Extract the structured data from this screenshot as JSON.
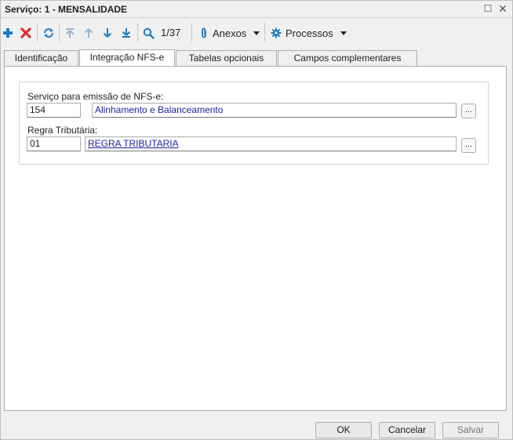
{
  "window": {
    "title": "Serviço: 1 - MENSALIDADE",
    "maximize_glyph": "☐",
    "close_glyph": "✕"
  },
  "toolbar": {
    "add_icon": "plus-icon",
    "delete_icon": "x-icon",
    "refresh_icon": "refresh-icon",
    "first_icon": "arrow-first-icon",
    "prev_icon": "arrow-up-icon",
    "next_icon": "arrow-down-icon",
    "last_icon": "arrow-last-icon",
    "search_icon": "search-icon",
    "record_position": "1/37",
    "attachments_label": "Anexos",
    "processes_label": "Processos",
    "accent_color": "#1e7bc4",
    "delete_color": "#d9312b"
  },
  "tabs": [
    {
      "label": "Identificação",
      "active": false
    },
    {
      "label": "Integração NFS-e",
      "active": true
    },
    {
      "label": "Tabelas opcionais",
      "active": false
    },
    {
      "label": "Campos complementares",
      "active": false
    }
  ],
  "form": {
    "service_label": "Serviço para emissão de NFS-e:",
    "service_code": "154",
    "service_description": "Alinhamento e Balanceamento",
    "tax_rule_label": "Regra Tributária:",
    "tax_rule_code": "01",
    "tax_rule_description": "REGRA TRIBUTARIA",
    "lookup_button": "...",
    "link_color": "#1f1fa0"
  },
  "footer": {
    "ok_label": "OK",
    "cancel_label": "Cancelar",
    "save_label": "Salvar"
  }
}
